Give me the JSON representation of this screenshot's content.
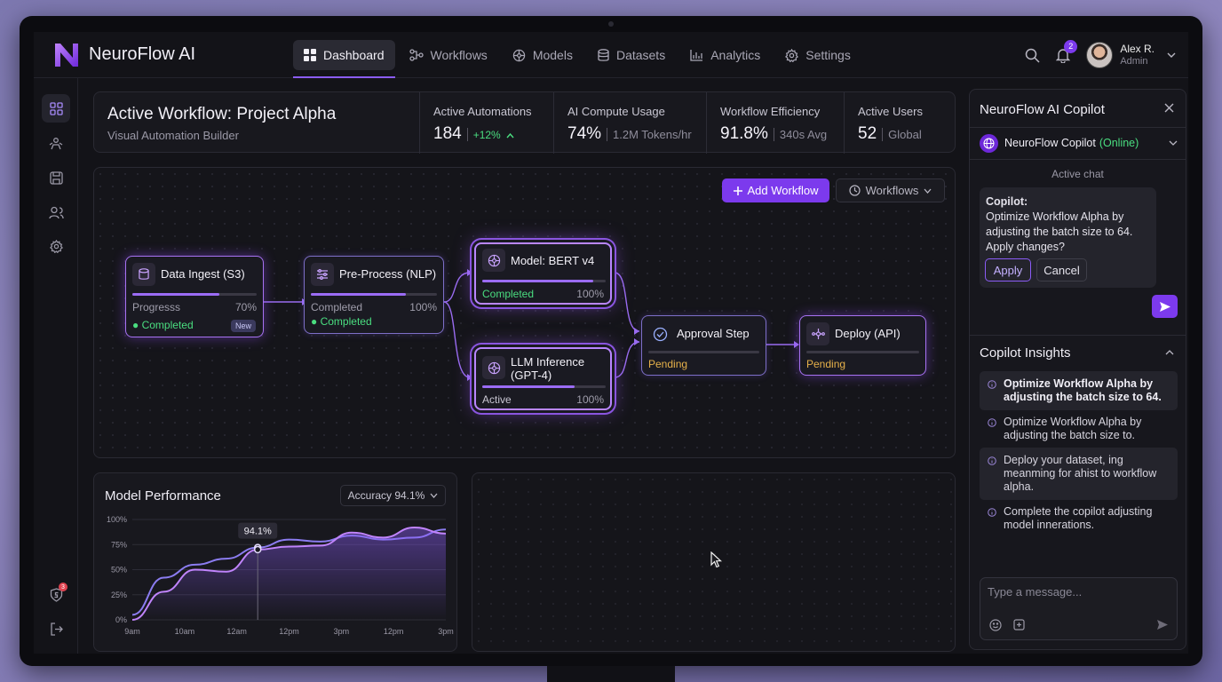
{
  "app": {
    "brand": "NeuroFlow AI"
  },
  "nav": [
    {
      "label": "Dashboard",
      "icon": "grid-icon",
      "active": true
    },
    {
      "label": "Workflows",
      "icon": "workflow-icon"
    },
    {
      "label": "Models",
      "icon": "model-icon"
    },
    {
      "label": "Datasets",
      "icon": "database-icon"
    },
    {
      "label": "Analytics",
      "icon": "bar-chart-icon"
    },
    {
      "label": "Settings",
      "icon": "gear-icon"
    }
  ],
  "user": {
    "name": "Alex R.",
    "role": "Admin",
    "notifications": "2"
  },
  "sidebar": {
    "alerts": "3"
  },
  "header": {
    "title": "Active Workflow: Project Alpha",
    "subtitle": "Visual Automation Builder",
    "stats": [
      {
        "label": "Active Automations",
        "value": "184",
        "sub": "+12%"
      },
      {
        "label": "AI Compute Usage",
        "value": "74%",
        "sub": "1.2M Tokens/hr"
      },
      {
        "label": "Workflow Efficiency",
        "value": "91.8%",
        "sub": "340s Avg"
      },
      {
        "label": "Active Users",
        "value": "52",
        "sub": "Global"
      }
    ]
  },
  "canvas": {
    "add_label": "Add Workflow",
    "filter_label": "Workflows",
    "nodes": {
      "ingest": {
        "title": "Data Ingest (S3)",
        "left": "Progresss",
        "right": "70%",
        "progress": 0.7,
        "status": "Completed",
        "badge": "New"
      },
      "preprocess": {
        "title": "Pre-Process (NLP)",
        "left": "Completed",
        "right": "100%",
        "progress": 0.75,
        "status": "Completed"
      },
      "bert": {
        "title": "Model: BERT v4",
        "left": "Completed",
        "right": "100%",
        "progress": 0.9
      },
      "llm": {
        "title": "LLM Inference (GPT-4)",
        "left": "Active",
        "right": "100%",
        "progress": 0.75
      },
      "approval": {
        "title": "Approval Step",
        "left": "Pending",
        "progress": 0
      },
      "deploy": {
        "title": "Deploy (API)",
        "left": "Pending",
        "progress": 0
      }
    }
  },
  "performance": {
    "title": "Model Performance",
    "dropdown": "Accuracy 94.1%"
  },
  "chart_data": {
    "type": "line",
    "categories": [
      "9am",
      "10am",
      "12am",
      "12pm",
      "3pm",
      "12pm",
      "3pm"
    ],
    "yticks": [
      "100%",
      "75%",
      "50%",
      "25%",
      "0%"
    ],
    "ylim": [
      0,
      100
    ],
    "series": [
      {
        "values": [
          5,
          42,
          55,
          61,
          72,
          80,
          78,
          84,
          80,
          82,
          90
        ]
      },
      {
        "values": [
          0,
          28,
          50,
          48,
          70,
          73,
          74,
          87,
          82,
          92,
          86
        ]
      }
    ],
    "annotation": {
      "label": "94.1%",
      "index": 4
    }
  },
  "copilot": {
    "title": "NeuroFlow AI Copilot",
    "agent": "NeuroFlow Copilot",
    "agent_status": "(Online)",
    "chat_label": "Active chat",
    "speaker": "Copilot:",
    "message": "Optimize Workflow Alpha by adjusting the batch size to 64. Apply changes?",
    "apply": "Apply",
    "cancel": "Cancel",
    "insights_title": "Copilot Insights",
    "insights": [
      "Optimize Workflow Alpha by adjusting the batch size to 64.",
      "Optimize Workflow Alpha by adjusting the batch size to.",
      "Deploy your dataset, ing meanming for ahist to workflow alpha.",
      "Complete the copilot adjusting model innerations."
    ],
    "input_placeholder": "Type a message..."
  },
  "colors": {
    "accent": "#7c3aed",
    "success": "#4ade80",
    "pending": "#e6b14a",
    "bg": "#131318"
  }
}
